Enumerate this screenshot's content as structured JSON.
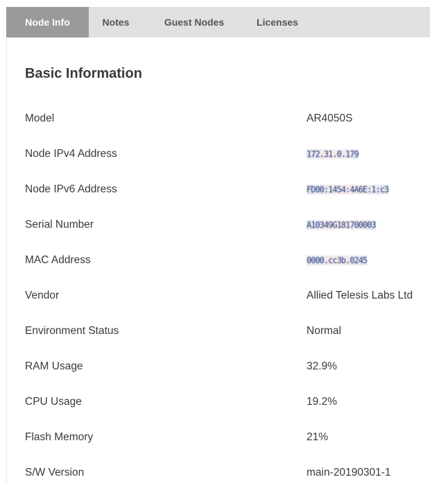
{
  "tabs": [
    {
      "label": "Node Info",
      "active": true
    },
    {
      "label": "Notes",
      "active": false
    },
    {
      "label": "Guest Nodes",
      "active": false
    },
    {
      "label": "Licenses",
      "active": false
    }
  ],
  "section_title": "Basic Information",
  "rows": [
    {
      "label": "Model",
      "value": "AR4050S"
    },
    {
      "label": "Node IPv4 Address",
      "value": "172.31.0.179"
    },
    {
      "label": "Node IPv6 Address",
      "value": "FD00:1454:4A6E:1:c3"
    },
    {
      "label": "Serial Number",
      "value": "A10349G181700003"
    },
    {
      "label": "MAC Address",
      "value": "0000.cc3b.0245"
    },
    {
      "label": "Vendor",
      "value": "Allied Telesis Labs Ltd"
    },
    {
      "label": "Environment Status",
      "value": "Normal"
    },
    {
      "label": "RAM Usage",
      "value": "32.9%"
    },
    {
      "label": "CPU Usage",
      "value": "19.2%"
    },
    {
      "label": "Flash Memory",
      "value": "21%"
    },
    {
      "label": "S/W Version",
      "value": "main-20190301-1"
    }
  ],
  "colors": {
    "tabbar_bg": "#e0e0e0",
    "tab_active_bg": "#9a9a9a",
    "text": "#3a3a3a"
  }
}
